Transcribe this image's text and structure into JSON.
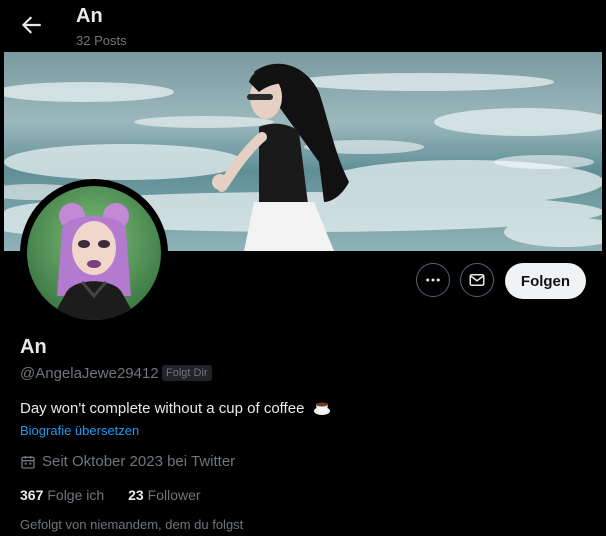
{
  "header": {
    "name": "An",
    "posts": "32 Posts"
  },
  "profile": {
    "name": "An",
    "handle": "@AngelaJewe29412",
    "follows_you_badge": "Folgt Dir",
    "bio": "Day won't complete without a cup of coffee",
    "bio_emoji": "coffee-cup-icon",
    "translate_link": "Biografie übersetzen",
    "joined": "Seit Oktober 2023 bei Twitter",
    "following_count": "367",
    "following_label": "Folge ich",
    "followers_count": "23",
    "followers_label": "Follower",
    "followed_by": "Gefolgt von niemandem, dem du folgst"
  },
  "actions": {
    "follow_label": "Folgen"
  },
  "colors": {
    "link": "#1d9bf0",
    "muted": "#71767b",
    "text": "#e7e9ea",
    "background": "#000000"
  }
}
